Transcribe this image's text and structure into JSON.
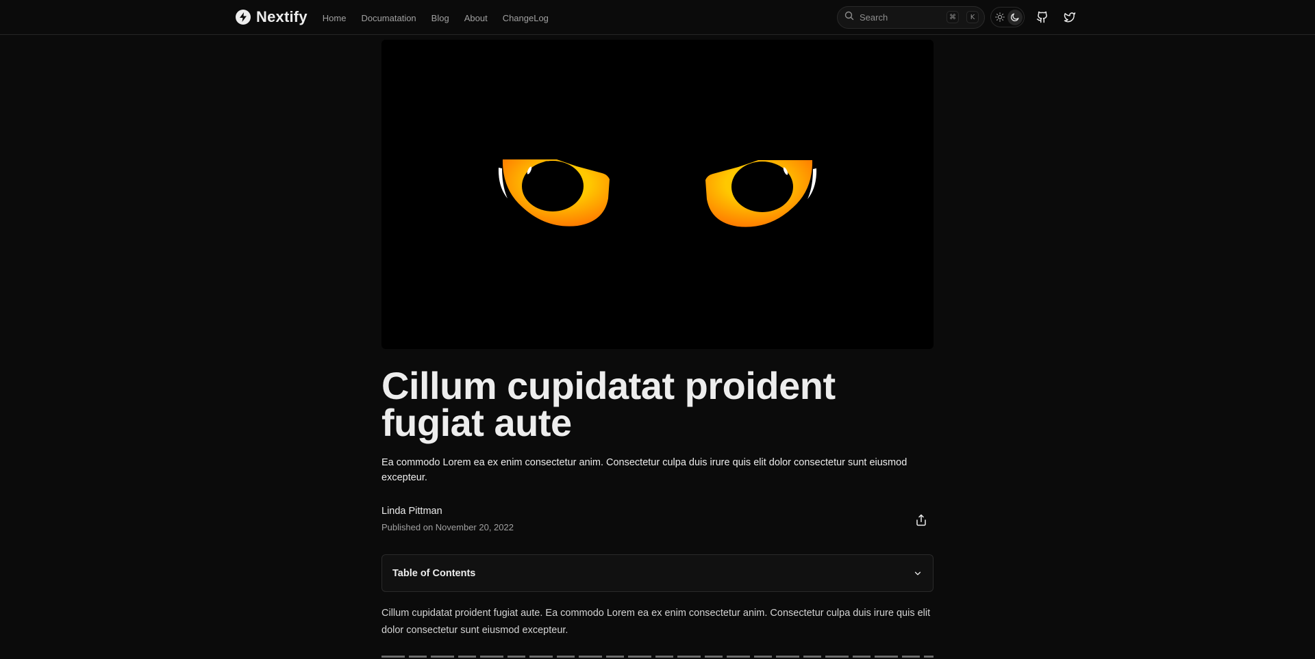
{
  "header": {
    "brand": "Nextify",
    "nav": [
      "Home",
      "Documatation",
      "Blog",
      "About",
      "ChangeLog"
    ],
    "search": {
      "placeholder": "Search",
      "shortcut": [
        "⌘",
        "K"
      ]
    },
    "theme": {
      "options": [
        "light",
        "dark"
      ],
      "active": "dark"
    },
    "social": [
      "github-icon",
      "twitter-icon"
    ]
  },
  "hero": {
    "alt": "Glowing orange cat eyes on black background",
    "colors": {
      "iris_outer": "#ff6a00",
      "iris_inner": "#ffc400"
    }
  },
  "article": {
    "title": "Cillum cupidatat proident fugiat aute",
    "description": "Ea commodo Lorem ea ex enim consectetur anim. Consectetur culpa duis irure quis elit dolor consectetur sunt eiusmod excepteur.",
    "author": "Linda Pittman",
    "published": "Published on November 20, 2022",
    "toc_label": "Table of Contents",
    "paragraphs": [
      "Cillum cupidatat proident fugiat aute. Ea commodo Lorem ea ex enim consectetur anim. Consectetur culpa duis irure quis elit dolor consectetur sunt eiusmod excepteur."
    ]
  }
}
